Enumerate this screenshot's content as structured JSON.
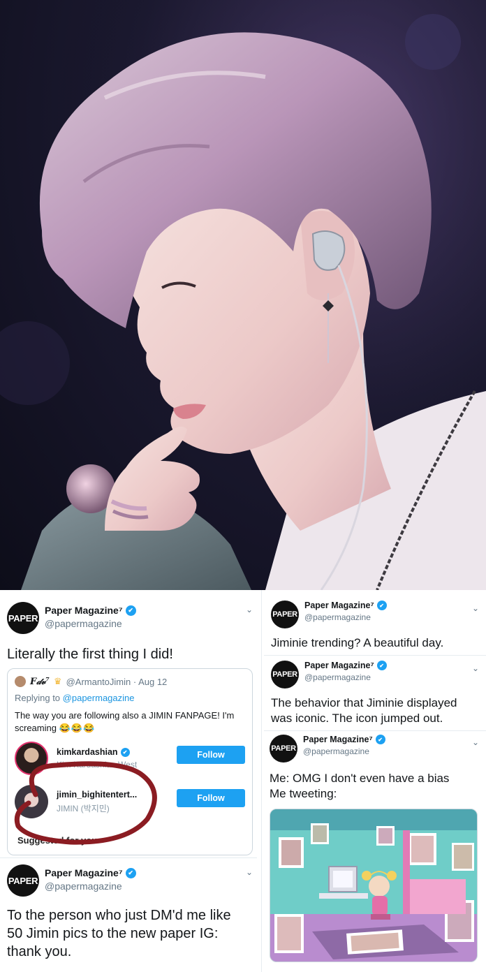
{
  "tweets": {
    "left_top": {
      "avatar_text": "PAPER",
      "name": "Paper Magazine⁷",
      "handle": "@papermagazine",
      "text": "Literally the first thing I did!",
      "quote": {
        "name": "F𝒹𝓋⁷",
        "handle_date": "@ArmantoJimin · Aug 12",
        "replying_label": "Replying to",
        "replying_to": "@papermagazine",
        "text": "The way you are following also a JIMIN FANPAGE! I'm screaming",
        "laugh": "😂😂😂",
        "suggestions": [
          {
            "username": "kimkardashian",
            "fullname": "Kim Kardashian West",
            "button": "Follow"
          },
          {
            "username": "jimin_bighitentert...",
            "fullname": "JIMIN (박지민)",
            "button": "Follow"
          }
        ],
        "suggested_label": "Suggested for you"
      }
    },
    "left_bottom": {
      "avatar_text": "PAPER",
      "name": "Paper Magazine⁷",
      "handle": "@papermagazine",
      "text": "To the person who just DM'd me like 50 Jimin pics to the new paper IG: thank you."
    },
    "right_1": {
      "avatar_text": "PAPER",
      "name": "Paper Magazine⁷",
      "handle": "@papermagazine",
      "text": "Jiminie trending? A beautiful day."
    },
    "right_2": {
      "avatar_text": "PAPER",
      "name": "Paper Magazine⁷",
      "handle": "@papermagazine",
      "text": "The behavior that Jiminie displayed was iconic. The icon jumped out."
    },
    "right_3": {
      "avatar_text": "PAPER",
      "name": "Paper Magazine⁷",
      "handle": "@papermagazine",
      "text_line1": "Me: OMG  I don't even have a bias",
      "text_line2": "Me tweeting:"
    }
  },
  "colors": {
    "twitter_blue": "#1da1f2",
    "verified": "#1da1f2",
    "scribble": "#8b1c22"
  },
  "icons": [
    "verified-icon",
    "chevron-down-icon"
  ]
}
